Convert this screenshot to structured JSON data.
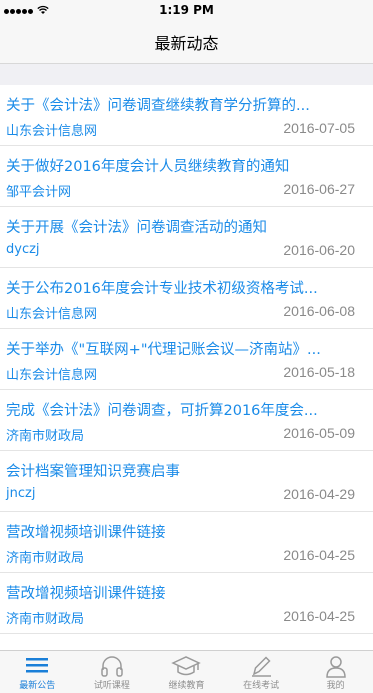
{
  "status_bar": {
    "time": "1:19 PM",
    "carrier": "",
    "battery": ""
  },
  "nav": {
    "title": "最新动态"
  },
  "news": [
    {
      "title": "关于《会计法》问卷调查继续教育学分折算的...",
      "source": "山东会计信息网",
      "date": "2016-07-05"
    },
    {
      "title": "关于做好2016年度会计人员继续教育的通知",
      "source": "邹平会计网",
      "date": "2016-06-27"
    },
    {
      "title": "关于开展《会计法》问卷调查活动的通知",
      "source": "dyczj",
      "date": "2016-06-20"
    },
    {
      "title": "关于公布2016年度会计专业技术初级资格考试...",
      "source": "山东会计信息网",
      "date": "2016-06-08"
    },
    {
      "title": "关于举办《\"互联网+\"代理记账会议—济南站》...",
      "source": "山东会计信息网",
      "date": "2016-05-18"
    },
    {
      "title": "完成《会计法》问卷调查，可折算2016年度会...",
      "source": "济南市财政局",
      "date": "2016-05-09"
    },
    {
      "title": "会计档案管理知识竞赛启事",
      "source": "jnczj",
      "date": "2016-04-29"
    },
    {
      "title": "营改增视频培训课件链接",
      "source": "济南市财政局",
      "date": "2016-04-25"
    },
    {
      "title": "营改增视频培训课件链接",
      "source": "济南市财政局",
      "date": "2016-04-25"
    }
  ],
  "tabs": [
    {
      "label": "最新公告",
      "icon": "menu-icon",
      "active": true
    },
    {
      "label": "试听课程",
      "icon": "headphones-icon",
      "active": false
    },
    {
      "label": "继续教育",
      "icon": "graduation-cap-icon",
      "active": false
    },
    {
      "label": "在线考试",
      "icon": "pencil-icon",
      "active": false
    },
    {
      "label": "我的",
      "icon": "user-icon",
      "active": false
    }
  ],
  "colors": {
    "accent": "#1a7fd8",
    "link": "#1a8be8",
    "date": "#8a8a8a"
  }
}
